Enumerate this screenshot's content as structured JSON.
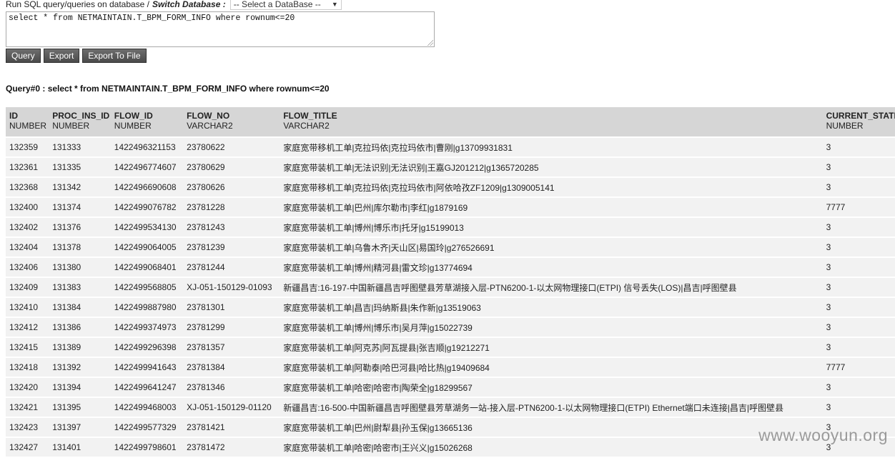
{
  "header": {
    "run_label": "Run SQL query/queries on database /",
    "switch_label": "Switch Database :",
    "db_select_value": "-- Select a DataBase --"
  },
  "sql_editor": {
    "value": "select * from NETMAINTAIN.T_BPM_FORM_INFO where rownum<=20"
  },
  "toolbar": {
    "query_label": "Query",
    "export_label": "Export",
    "export_file_label": "Export To File"
  },
  "result": {
    "title": "Query#0 : select * from NETMAINTAIN.T_BPM_FORM_INFO where rownum<=20",
    "columns": [
      {
        "name": "ID",
        "type": "NUMBER"
      },
      {
        "name": "PROC_INS_ID",
        "type": "NUMBER"
      },
      {
        "name": "FLOW_ID",
        "type": "NUMBER"
      },
      {
        "name": "FLOW_NO",
        "type": "VARCHAR2"
      },
      {
        "name": "FLOW_TITLE",
        "type": "VARCHAR2"
      },
      {
        "name": "CURRENT_STATE",
        "type": "NUMBER"
      }
    ],
    "rows": [
      [
        "132359",
        "131333",
        "1422496321153",
        "23780622",
        "家庭宽带移机工单|克拉玛依|克拉玛依市|曹刚|g13709931831",
        "3"
      ],
      [
        "132361",
        "131335",
        "1422496774607",
        "23780629",
        "家庭宽带装机工单|无法识别|无法识别|王嘉GJ201212|g1365720285",
        "3"
      ],
      [
        "132368",
        "131342",
        "1422496690608",
        "23780626",
        "家庭宽带移机工单|克拉玛依|克拉玛依市|阿依哈孜ZF1209|g1309005141",
        "3"
      ],
      [
        "132400",
        "131374",
        "1422499076782",
        "23781228",
        "家庭宽带装机工单|巴州|库尔勒市|李红|g1879169",
        "7777"
      ],
      [
        "132402",
        "131376",
        "1422499534130",
        "23781243",
        "家庭宽带装机工单|博州|博乐市|托牙|g15199013",
        "3"
      ],
      [
        "132404",
        "131378",
        "1422499064005",
        "23781239",
        "家庭宽带装机工单|乌鲁木齐|天山区|易国玲|g276526691",
        "3"
      ],
      [
        "132406",
        "131380",
        "1422499068401",
        "23781244",
        "家庭宽带装机工单|博州|精河县|雷文珍|g13774694",
        "3"
      ],
      [
        "132409",
        "131383",
        "1422499568805",
        "XJ-051-150129-01093",
        "新疆昌吉:16-197-中国新疆昌吉呼图壁县芳草湖接入层-PTN6200-1-以太网物理接口(ETPI) 信号丢失(LOS)|昌吉|呼图壁县",
        "3"
      ],
      [
        "132410",
        "131384",
        "1422499887980",
        "23781301",
        "家庭宽带装机工单|昌吉|玛纳斯县|朱作新|g13519063",
        "3"
      ],
      [
        "132412",
        "131386",
        "1422499374973",
        "23781299",
        "家庭宽带装机工单|博州|博乐市|吴月萍|g15022739",
        "3"
      ],
      [
        "132415",
        "131389",
        "1422499296398",
        "23781357",
        "家庭宽带装机工单|阿克苏|阿瓦提县|张吉顺|g19212271",
        "3"
      ],
      [
        "132418",
        "131392",
        "1422499941643",
        "23781384",
        "家庭宽带装机工单|阿勒泰|哈巴河县|哈比热|g19409684",
        "7777"
      ],
      [
        "132420",
        "131394",
        "1422499641247",
        "23781346",
        "家庭宽带装机工单|哈密|哈密市|陶荣全|g18299567",
        "3"
      ],
      [
        "132421",
        "131395",
        "1422499468003",
        "XJ-051-150129-01120",
        "新疆昌吉:16-500-中国新疆昌吉呼图壁县芳草湖务一站-接入层-PTN6200-1-以太网物理接口(ETPI) Ethernet端口未连接|昌吉|呼图壁县",
        "3"
      ],
      [
        "132423",
        "131397",
        "1422499577329",
        "23781421",
        "家庭宽带装机工单|巴州|尉犁县|孙玉保|g13665136",
        "3"
      ],
      [
        "132427",
        "131401",
        "1422499798601",
        "23781472",
        "家庭宽带装机工单|哈密|哈密市|王兴义|g15026268",
        "3"
      ]
    ]
  },
  "watermark": {
    "text": "www.wooyun.org"
  },
  "colors": {
    "header_bg": "#d6d6d6",
    "row_bg": "#f2f2f2",
    "button_bg": "#555555"
  }
}
